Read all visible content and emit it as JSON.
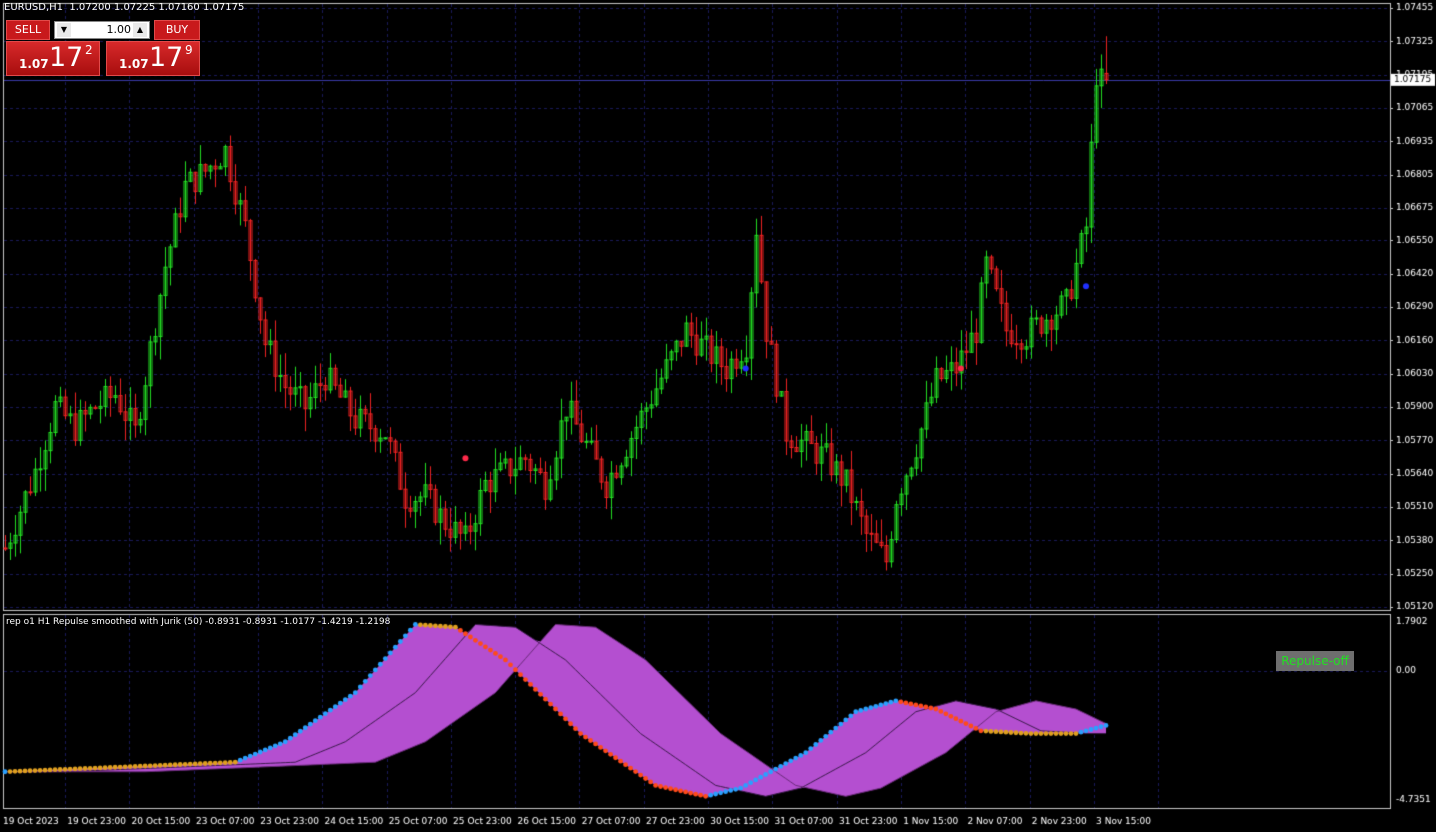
{
  "header": {
    "symbol_line": "EURUSD,H1  1.07200 1.07225 1.07160 1.07175"
  },
  "trade_panel": {
    "sell_label": "SELL",
    "buy_label": "BUY",
    "lot_value": "1.00",
    "sell_prefix": "1.07",
    "sell_big": "17",
    "sell_sup": "2",
    "buy_prefix": "1.07",
    "buy_big": "17",
    "buy_sup": "9"
  },
  "indicator": {
    "caption": "rep o1 H1 Repulse smoothed with Jurik (50) -0.8931 -0.8931 -1.0177 -1.4219 -1.2198",
    "button_label": "Repulse-off",
    "axis_labels": [
      "1.7902",
      "0.00",
      "-4.7351"
    ]
  },
  "price_axis": {
    "labels": [
      "1.07455",
      "1.07325",
      "1.07195",
      "1.07065",
      "1.06935",
      "1.06805",
      "1.06675",
      "1.06550",
      "1.06420",
      "1.06290",
      "1.06160",
      "1.06030",
      "1.05900",
      "1.05770",
      "1.05640",
      "1.05510",
      "1.05380",
      "1.05250",
      "1.05120"
    ],
    "current_price": "1.07175"
  },
  "time_axis": {
    "labels": [
      "19 Oct 2023",
      "19 Oct 23:00",
      "20 Oct 15:00",
      "23 Oct 07:00",
      "23 Oct 23:00",
      "24 Oct 15:00",
      "25 Oct 07:00",
      "25 Oct 23:00",
      "26 Oct 15:00",
      "27 Oct 07:00",
      "27 Oct 23:00",
      "30 Oct 15:00",
      "31 Oct 07:00",
      "31 Oct 23:00",
      "1 Nov 15:00",
      "2 Nov 07:00",
      "2 Nov 23:00",
      "3 Nov 15:00"
    ]
  },
  "colors": {
    "bull": "#22dd22",
    "bear": "#ee2222",
    "grid": "#1a1a5a",
    "band": "#b44fd0",
    "line_up": "#2aa0ff",
    "line_down": "#ff4a1a",
    "line_flat": "#e0a020"
  },
  "chart_data": {
    "type": "candlestick",
    "symbol": "EURUSD",
    "timeframe": "H1",
    "ohlc_last": {
      "open": 1.072,
      "high": 1.07225,
      "low": 1.0716,
      "close": 1.07175
    },
    "ylim": [
      1.0512,
      1.07455
    ],
    "close_path": [
      [
        0,
        1.0535
      ],
      [
        6,
        1.0565
      ],
      [
        10,
        1.059
      ],
      [
        14,
        1.0582
      ],
      [
        18,
        1.059
      ],
      [
        22,
        1.0595
      ],
      [
        26,
        1.058
      ],
      [
        32,
        1.0645
      ],
      [
        36,
        1.0676
      ],
      [
        40,
        1.0682
      ],
      [
        44,
        1.069
      ],
      [
        48,
        1.066
      ],
      [
        52,
        1.0615
      ],
      [
        56,
        1.0598
      ],
      [
        60,
        1.059
      ],
      [
        64,
        1.0602
      ],
      [
        70,
        1.0585
      ],
      [
        76,
        1.058
      ],
      [
        80,
        1.0555
      ],
      [
        84,
        1.0555
      ],
      [
        88,
        1.0545
      ],
      [
        92,
        1.0538
      ],
      [
        96,
        1.056
      ],
      [
        100,
        1.0565
      ],
      [
        104,
        1.057
      ],
      [
        108,
        1.056
      ],
      [
        112,
        1.059
      ],
      [
        116,
        1.0575
      ],
      [
        120,
        1.056
      ],
      [
        124,
        1.0575
      ],
      [
        128,
        1.059
      ],
      [
        132,
        1.0605
      ],
      [
        136,
        1.062
      ],
      [
        140,
        1.0612
      ],
      [
        144,
        1.0605
      ],
      [
        148,
        1.0615
      ],
      [
        150,
        1.066
      ],
      [
        152,
        1.062
      ],
      [
        156,
        1.058
      ],
      [
        160,
        1.0575
      ],
      [
        164,
        1.057
      ],
      [
        168,
        1.056
      ],
      [
        172,
        1.054
      ],
      [
        176,
        1.053
      ],
      [
        178,
        1.0555
      ],
      [
        182,
        1.0575
      ],
      [
        186,
        1.06
      ],
      [
        190,
        1.0605
      ],
      [
        194,
        1.062
      ],
      [
        196,
        1.0645
      ],
      [
        200,
        1.062
      ],
      [
        204,
        1.0618
      ],
      [
        208,
        1.0625
      ],
      [
        212,
        1.063
      ],
      [
        214,
        1.0645
      ],
      [
        216,
        1.066
      ],
      [
        218,
        1.072
      ],
      [
        220,
        1.0713
      ]
    ],
    "signal_dots": [
      {
        "bar": 92,
        "price": 1.057,
        "color": "red"
      },
      {
        "bar": 148,
        "price": 1.0605,
        "color": "blue"
      },
      {
        "bar": 191,
        "price": 1.0605,
        "color": "red"
      },
      {
        "bar": 216,
        "price": 1.0637,
        "color": "blue"
      }
    ],
    "indicator": {
      "name": "Repulse smoothed with Jurik (50)",
      "ylim": [
        -4.7351,
        1.7902
      ],
      "values": [
        -0.8931,
        -0.8931,
        -1.0177,
        -1.4219,
        -1.2198
      ],
      "main_path": [
        [
          0,
          -3.7
        ],
        [
          20,
          -3.55
        ],
        [
          46,
          -3.35
        ],
        [
          56,
          -2.6
        ],
        [
          70,
          -0.8
        ],
        [
          82,
          1.7
        ],
        [
          90,
          1.6
        ],
        [
          100,
          0.4
        ],
        [
          115,
          -2.3
        ],
        [
          130,
          -4.2
        ],
        [
          140,
          -4.6
        ],
        [
          147,
          -4.3
        ],
        [
          160,
          -3.0
        ],
        [
          170,
          -1.5
        ],
        [
          178,
          -1.1
        ],
        [
          186,
          -1.4
        ],
        [
          195,
          -2.2
        ],
        [
          205,
          -2.3
        ],
        [
          214,
          -2.3
        ],
        [
          220,
          -2.0
        ]
      ]
    }
  }
}
